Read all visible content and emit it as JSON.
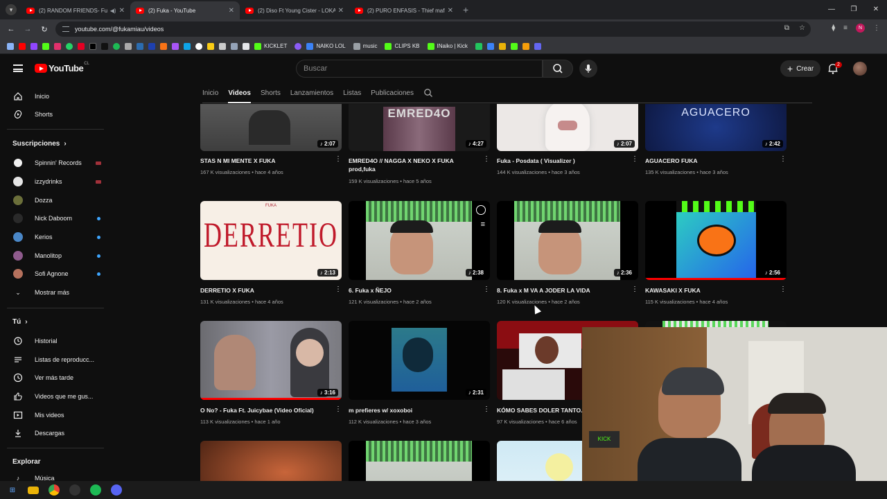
{
  "browser": {
    "tabs": [
      {
        "title": "(2) RANDOM FRIENDS- Fu",
        "has_sound": true
      },
      {
        "title": "(2) Fuka - YouTube",
        "active": true
      },
      {
        "title": "(2) Diso Ft Young Cister - LOKA"
      },
      {
        "title": "(2) PURO ENFASIS - Thief mafia"
      }
    ],
    "url": "youtube.com/@fukamiau/videos",
    "profile_initial": "N",
    "bookmarks": [
      {
        "label": "KICKLET",
        "color": "#53fc18"
      },
      {
        "label": "NAIKO LOL",
        "color": "#3b82f6"
      },
      {
        "label": "music",
        "color": "#9aa0a6"
      },
      {
        "label": "CLIPS KB",
        "color": "#53fc18"
      },
      {
        "label": "INaiko | Kick",
        "color": "#53fc18"
      }
    ]
  },
  "youtube": {
    "logo_text": "YouTube",
    "logo_region": "CL",
    "search_placeholder": "Buscar",
    "create_label": "Crear",
    "notif_count": "2"
  },
  "sidebar": {
    "main": [
      {
        "label": "Inicio",
        "icon": "home-icon"
      },
      {
        "label": "Shorts",
        "icon": "shorts-icon"
      }
    ],
    "subs_title": "Suscripciones",
    "subs": [
      {
        "label": "Spinnin' Records",
        "color": "#2d6ee9",
        "indicator": "live"
      },
      {
        "label": "izzydrinks",
        "color": "#e5e5e5",
        "indicator": "live"
      },
      {
        "label": "Dozza",
        "color": "#6b6f3a",
        "indicator": ""
      },
      {
        "label": "Nick Daboom",
        "color": "#1a1a1a",
        "indicator": "new"
      },
      {
        "label": "Kerios",
        "color": "#4a87c7",
        "indicator": "new"
      },
      {
        "label": "Manolitop",
        "color": "#8f5b8d",
        "indicator": "new"
      },
      {
        "label": "Sofi Agnone",
        "color": "#b5715d",
        "indicator": "new"
      }
    ],
    "show_more": "Mostrar más",
    "you_title": "Tú",
    "you": [
      {
        "label": "Historial",
        "icon": "history-icon"
      },
      {
        "label": "Listas de reproducc...",
        "icon": "playlist-icon"
      },
      {
        "label": "Ver más tarde",
        "icon": "clock-icon"
      },
      {
        "label": "Videos que me gus...",
        "icon": "like-icon"
      },
      {
        "label": "Mis videos",
        "icon": "my-videos-icon"
      },
      {
        "label": "Descargas",
        "icon": "download-icon"
      }
    ],
    "explore_title": "Explorar",
    "explore": [
      {
        "label": "Música",
        "icon": "music-icon"
      }
    ]
  },
  "channel_tabs": [
    "Inicio",
    "Videos",
    "Shorts",
    "Lanzamientos",
    "Listas",
    "Publicaciones"
  ],
  "active_channel_tab": "Videos",
  "videos": [
    {
      "title": "STAS N MI MENTE X FUKA",
      "views": "167 K visualizaciones",
      "age": "hace 4 años",
      "duration": "2:07",
      "thumb": "#5a5a5a"
    },
    {
      "title": "EMRED4O // NAGGA X NEKO X FUKA prod,fuka",
      "views": "159 K visualizaciones",
      "age": "hace 5 años",
      "duration": "4:27",
      "thumb": "#2b2b2b"
    },
    {
      "title": "Fuka - Posdata ( Visualizer )",
      "views": "144 K visualizaciones",
      "age": "hace 3 años",
      "duration": "2:07",
      "thumb": "#e8e4e2"
    },
    {
      "title": "AGUACERO FUKA",
      "views": "135 K visualizaciones",
      "age": "hace 3 años",
      "duration": "2:42",
      "thumb": "#0e1e4a"
    },
    {
      "title": "DERRETIO X FUKA",
      "views": "131 K visualizaciones",
      "age": "hace 4 años",
      "duration": "2:13",
      "thumb": "#f7efe6"
    },
    {
      "title": "6. Fuka x ÑEJO",
      "views": "121 K visualizaciones",
      "age": "hace 2 años",
      "duration": "2:38",
      "thumb": "#d9dcd5"
    },
    {
      "title": "8. Fuka x M VA A JODER LA VIDA",
      "views": "120 K visualizaciones",
      "age": "hace 2 años",
      "duration": "2:36",
      "thumb": "#d9dcd5"
    },
    {
      "title": "KAWASAKI X FUKA",
      "views": "115 K visualizaciones",
      "age": "hace 4 años",
      "duration": "2:56",
      "thumb": "#2d6fd6"
    },
    {
      "title": "O No? - Fuka Ft. Juicybae (Video Oficial)",
      "views": "113 K visualizaciones",
      "age": "hace 1 año",
      "duration": "3:16",
      "thumb": "#8a8a8a"
    },
    {
      "title": "m prefieres w/ xoxoboi",
      "views": "112 K visualizaciones",
      "age": "hace 3 años",
      "duration": "2:31",
      "thumb": "#0a0a0a"
    },
    {
      "title": "KÓMO SABES DOLER TANTO...",
      "views": "97 K visualizaciones",
      "age": "hace 6 años",
      "duration": "",
      "thumb": "#5b0d10"
    },
    {
      "title": "",
      "views": "",
      "age": "",
      "duration": "",
      "thumb": "#e8e8e8"
    },
    {
      "title": "",
      "views": "",
      "age": "",
      "duration": "",
      "thumb": "#6b3a1e"
    },
    {
      "title": "",
      "views": "",
      "age": "",
      "duration": "",
      "thumb": "#d9dcd5"
    },
    {
      "title": "",
      "views": "",
      "age": "",
      "duration": "",
      "thumb": "#cfe9f4"
    }
  ]
}
